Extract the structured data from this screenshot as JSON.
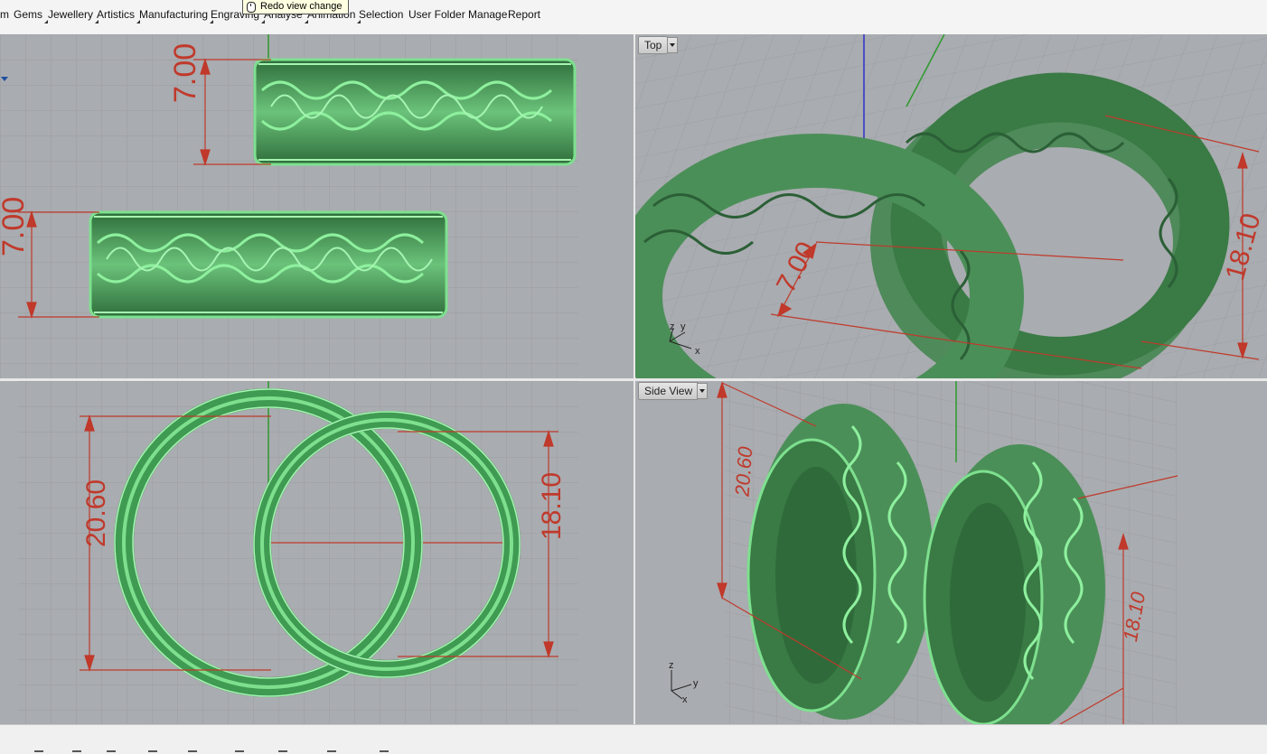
{
  "menu": {
    "items": [
      {
        "label": "m"
      },
      {
        "label": "Gems"
      },
      {
        "label": "Jewellery"
      },
      {
        "label": "Artistics"
      },
      {
        "label": "Manufacturing"
      },
      {
        "label": "Engraving"
      },
      {
        "label": "Analyse"
      },
      {
        "label": "Animation"
      },
      {
        "label": "Selection"
      },
      {
        "label": "User Folder Manage"
      },
      {
        "label": "Report"
      }
    ]
  },
  "tooltip": {
    "text": "Redo view change",
    "icon": "mouse-icon"
  },
  "viewports": {
    "top_left": {
      "dimensions": [
        "7.00",
        "7.00"
      ]
    },
    "top_right": {
      "label": "Top",
      "dimensions": [
        "7.00",
        "18.10"
      ],
      "axes": [
        "z",
        "y",
        "x"
      ]
    },
    "bottom_left": {
      "dimensions": [
        "20.60",
        "18.10"
      ]
    },
    "bottom_right": {
      "label": "Side View",
      "dimensions": [
        "20.60",
        "18.10"
      ],
      "axes": [
        "z",
        "y",
        "x"
      ]
    }
  },
  "colors": {
    "viewport_bg": "#a9acb0",
    "grid": "#9a9da1",
    "ring_green": "#3f9a52",
    "ring_highlight": "#7ee08f",
    "dimension_red": "#c0392b",
    "axis_green": "#2e9a2e",
    "axis_blue": "#3030c8"
  }
}
